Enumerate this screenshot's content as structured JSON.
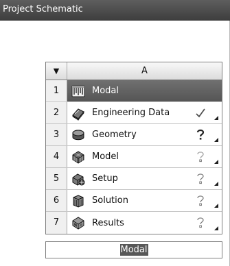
{
  "panel": {
    "title": "Project Schematic"
  },
  "system": {
    "column_header": "A",
    "header_arrow_icon": "triangle-down-icon",
    "rows": [
      {
        "number": "1",
        "label": "Modal",
        "icon": "modal-analysis-icon",
        "status": "none",
        "selected": true
      },
      {
        "number": "2",
        "label": "Engineering Data",
        "icon": "engineering-data-icon",
        "status": "up-to-date-check"
      },
      {
        "number": "3",
        "label": "Geometry",
        "icon": "geometry-icon",
        "status": "attention-required-question"
      },
      {
        "number": "4",
        "label": "Model",
        "icon": "model-icon",
        "status": "unfulfilled-question"
      },
      {
        "number": "5",
        "label": "Setup",
        "icon": "setup-icon",
        "status": "unfulfilled-question"
      },
      {
        "number": "6",
        "label": "Solution",
        "icon": "solution-icon",
        "status": "unfulfilled-question"
      },
      {
        "number": "7",
        "label": "Results",
        "icon": "results-icon",
        "status": "unfulfilled-question"
      }
    ],
    "name": "Modal"
  },
  "colors": {
    "title_bar": "#4a4a4a",
    "selected_row": "#606060",
    "check": "#505050",
    "question_dark": "#222222",
    "question_light": "#7a7a7a"
  }
}
